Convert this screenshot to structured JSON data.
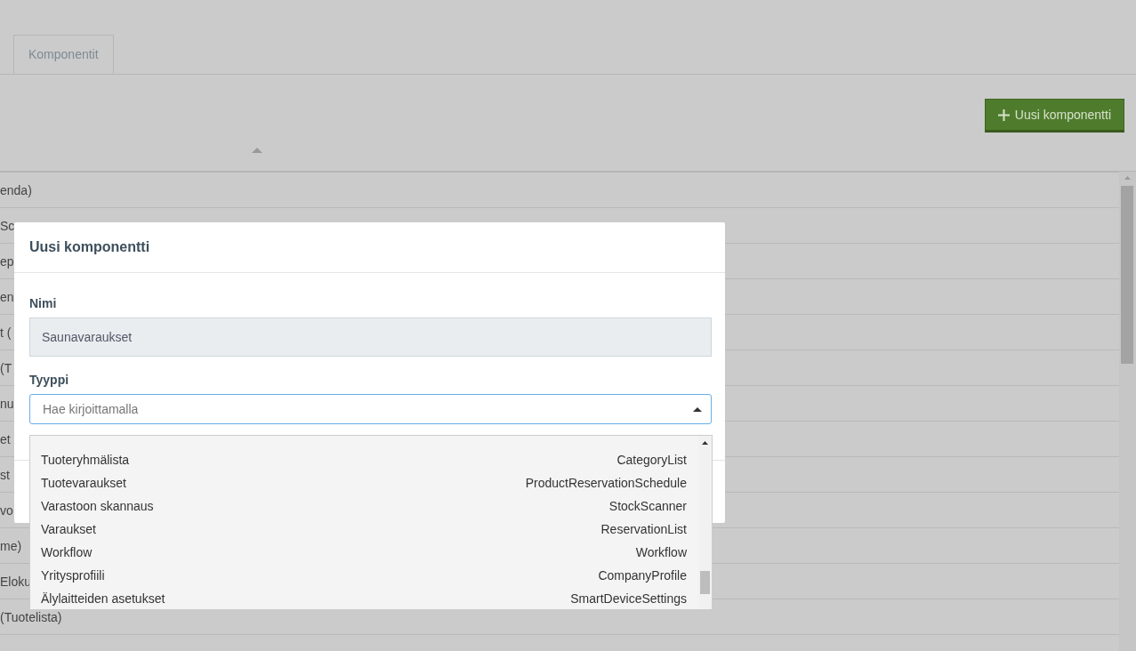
{
  "tabs": [
    {
      "label": "Komponentit",
      "selected": true
    }
  ],
  "new_button": {
    "label": "Uusi komponentti"
  },
  "table": {
    "rows": [
      "enda)",
      "Sc",
      "ep",
      "en",
      "t (",
      "(T",
      "nu",
      "et",
      "st",
      "vo",
      "me)",
      "Eloku",
      "(Tuotelista)"
    ]
  },
  "modal": {
    "title": "Uusi komponentti",
    "name_field": {
      "label": "Nimi",
      "value": "Saunavaraukset",
      "disabled": true
    },
    "type_field": {
      "label": "Tyyppi",
      "placeholder": "Hae kirjoittamalla",
      "expanded": true
    },
    "options": [
      {
        "label": "Tuoteryhmälista",
        "type": "CategoryList"
      },
      {
        "label": "Tuotevaraukset",
        "type": "ProductReservationSchedule"
      },
      {
        "label": "Varastoon skannaus",
        "type": "StockScanner"
      },
      {
        "label": "Varaukset",
        "type": "ReservationList"
      },
      {
        "label": "Workflow",
        "type": "Workflow"
      },
      {
        "label": "Yritysprofiili",
        "type": "CompanyProfile"
      },
      {
        "label": "Älylaitteiden asetukset",
        "type": "SmartDeviceSettings"
      }
    ]
  }
}
